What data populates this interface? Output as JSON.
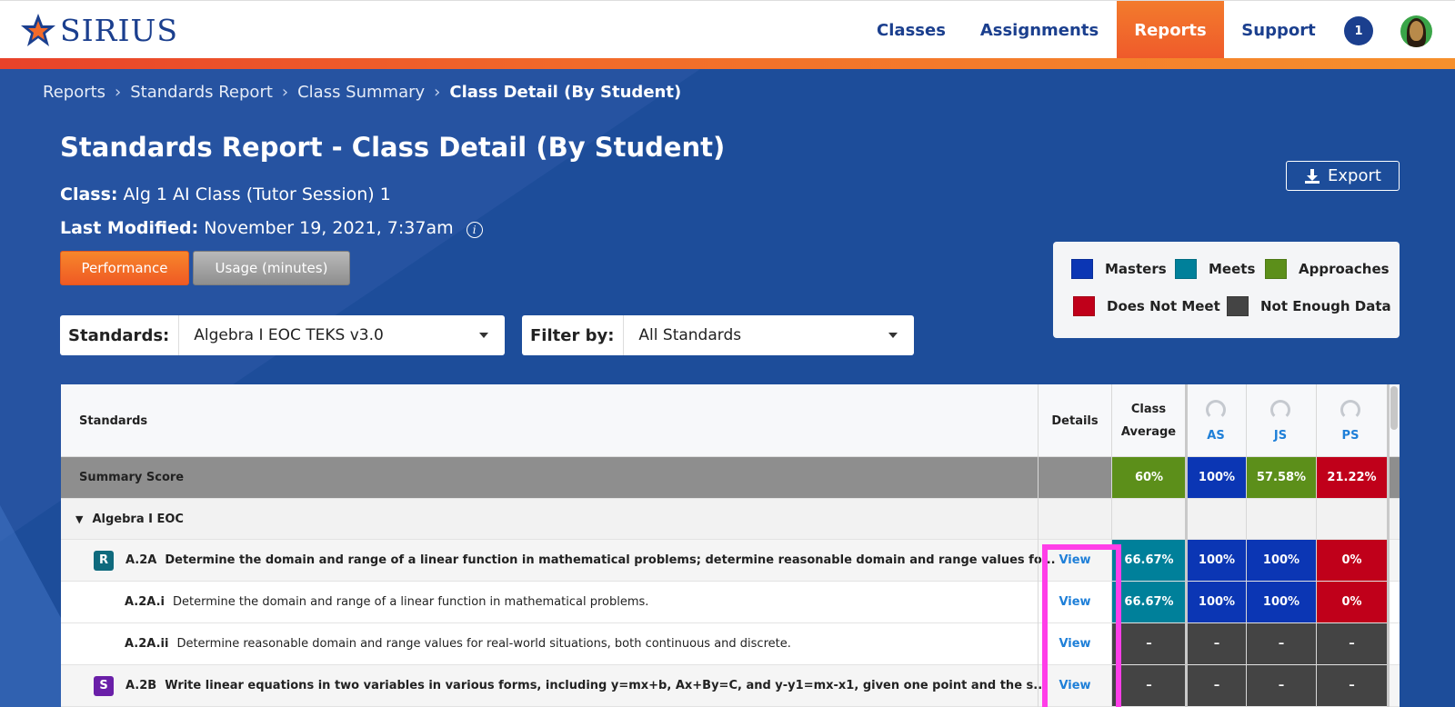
{
  "nav": {
    "logo_text": "SIRIUS",
    "items": [
      {
        "label": "Classes"
      },
      {
        "label": "Assignments"
      },
      {
        "label": "Reports"
      },
      {
        "label": "Support"
      }
    ],
    "notification_count": "1",
    "active_item": "Reports"
  },
  "breadcrumb": {
    "items": [
      "Reports",
      "Standards Report",
      "Class Summary"
    ],
    "current": "Class Detail (By Student)"
  },
  "page": {
    "title": "Standards Report - Class Detail (By Student)",
    "class_label": "Class:",
    "class_value": "Alg 1 AI Class (Tutor Session) 1",
    "modified_label": "Last Modified:",
    "modified_value": "November 19, 2021, 7:37am",
    "info_glyph": "i"
  },
  "buttons": {
    "performance": "Performance",
    "usage": "Usage (minutes)",
    "export": "Export"
  },
  "legend": {
    "masters": "Masters",
    "meets": "Meets",
    "approaches": "Approaches",
    "does_not_meet": "Does Not Meet",
    "not_enough_data": "Not Enough Data"
  },
  "colors": {
    "masters": "#0b36b4",
    "meets": "#00809a",
    "approaches": "#5c8f1a",
    "does_not_meet": "#c0001a",
    "not_enough_data": "#444444",
    "accent_orange": "#f26a2a",
    "brand_blue": "#1b3f8e"
  },
  "filters": {
    "standards_label": "Standards:",
    "standards_value": "Algebra I EOC TEKS v3.0",
    "filterby_label": "Filter by:",
    "filterby_value": "All Standards"
  },
  "table": {
    "headers": {
      "standards": "Standards",
      "details": "Details",
      "class_avg_1": "Class",
      "class_avg_2": "Average",
      "students": [
        "AS",
        "JS",
        "PS"
      ]
    },
    "summary": {
      "label": "Summary Score",
      "class_avg": "60%",
      "scores": [
        "100%",
        "57.58%",
        "21.22%"
      ]
    },
    "group": {
      "label": "Algebra I EOC"
    },
    "rows": [
      {
        "badge": "R",
        "code": "A.2A",
        "text": "Determine the domain and range of a linear function in mathematical problems; determine reasonable domain and range values fo...",
        "view": "View",
        "class_avg": "66.67%",
        "scores": [
          "100%",
          "100%",
          "0%"
        ]
      },
      {
        "code": "A.2A.i",
        "text": "Determine the domain and range of a linear function in mathematical problems.",
        "view": "View",
        "class_avg": "66.67%",
        "scores": [
          "100%",
          "100%",
          "0%"
        ]
      },
      {
        "code": "A.2A.ii",
        "text": "Determine reasonable domain and range values for real-world situations, both continuous and discrete.",
        "view": "View",
        "class_avg": "–",
        "scores": [
          "–",
          "–",
          "–"
        ]
      },
      {
        "badge": "S",
        "code": "A.2B",
        "text": "Write linear equations in two variables in various forms, including y=mx+b, Ax+By=C, and y-y1=mx-x1, given one point and the s...",
        "view": "View",
        "class_avg": "–",
        "scores": [
          "–",
          "–",
          "–"
        ]
      }
    ]
  }
}
